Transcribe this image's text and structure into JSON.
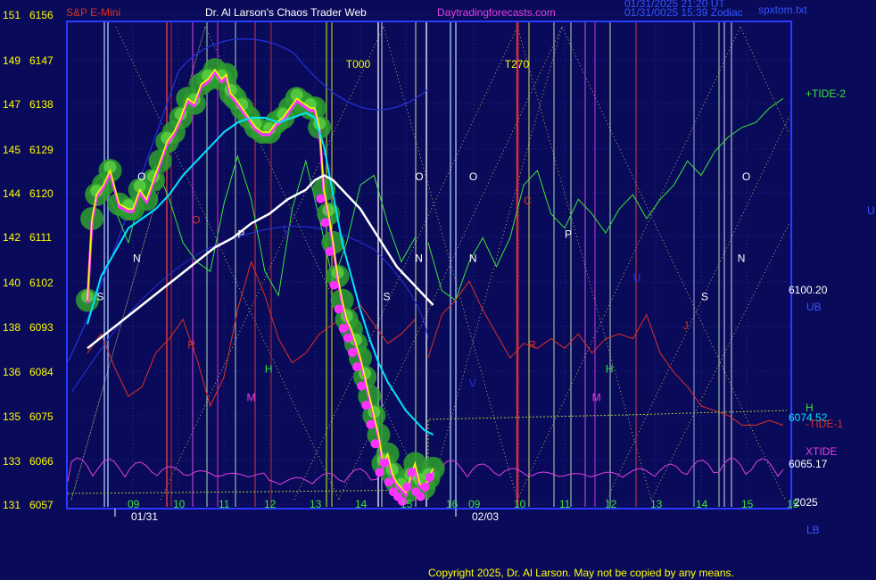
{
  "header": {
    "symbol": "S&P E-Mini",
    "author": "Dr. Al Larson's Chaos Trader Web",
    "site": "Daytradingforecasts.com",
    "stamp1": "01/31/2025 21:20 UT",
    "stamp2": "01/31/0025 15:39 Zodiac",
    "file": "spxtom.txt"
  },
  "footer": {
    "copyright": "Copyright 2025, Dr. Al Larson. May not be copied by any means."
  },
  "colors": {
    "background": "#0a0a5a",
    "frame": "#2a3aff",
    "price": "#ffff00",
    "price_glow": "#2ea02e",
    "avg_fast": "#00e5ff",
    "avg_slow": "#ffffff",
    "tide2": "#39e639",
    "tide1": "#e03020",
    "xtide": "#e040e0",
    "dots": "#ff33ff",
    "h_line": "#9acd32",
    "upper_band": "#2233dd"
  },
  "chart_data": {
    "type": "line",
    "title": "S&P E-Mini",
    "y_left": {
      "labels_a": [
        "151",
        "149",
        "147",
        "145",
        "144",
        "142",
        "140",
        "138",
        "136",
        "135",
        "133",
        "131"
      ],
      "labels_b": [
        "6156",
        "6147",
        "6138",
        "6129",
        "6120",
        "6111",
        "6102",
        "6093",
        "6084",
        "6075",
        "6066",
        "6057"
      ],
      "range": [
        6057,
        6156
      ]
    },
    "x_ticks": [
      {
        "label": "09",
        "day": 0,
        "hour": 9
      },
      {
        "label": "10",
        "day": 0,
        "hour": 10
      },
      {
        "label": "11",
        "day": 0,
        "hour": 11
      },
      {
        "label": "12",
        "day": 0,
        "hour": 12
      },
      {
        "label": "13",
        "day": 0,
        "hour": 13
      },
      {
        "label": "14",
        "day": 0,
        "hour": 14
      },
      {
        "label": "15",
        "day": 0,
        "hour": 15
      },
      {
        "label": "16",
        "day": 0,
        "hour": 16
      },
      {
        "label": "09",
        "day": 1,
        "hour": 9
      },
      {
        "label": "10",
        "day": 1,
        "hour": 10
      },
      {
        "label": "11",
        "day": 1,
        "hour": 11
      },
      {
        "label": "12",
        "day": 1,
        "hour": 12
      },
      {
        "label": "13",
        "day": 1,
        "hour": 13
      },
      {
        "label": "14",
        "day": 1,
        "hour": 14
      },
      {
        "label": "15",
        "day": 1,
        "hour": 15
      },
      {
        "label": "15",
        "day": 1,
        "hour": 16
      }
    ],
    "dates": [
      {
        "label": "01/31",
        "day": 0,
        "hour": 9
      },
      {
        "label": "02/03",
        "day": 1,
        "hour": 9
      }
    ],
    "year": "2025",
    "right_labels": {
      "upper": "U",
      "tide2": "+TIDE-2",
      "price": "6100.20",
      "ub": "UB",
      "h": "H",
      "level1": "6074.52",
      "tide1": "-TIDE-1",
      "xtide": "XTIDE",
      "level2": "6065.17",
      "lb": "LB"
    },
    "markers": [
      {
        "text": "T000",
        "day": 0,
        "hour": 13.8,
        "price": 6148
      },
      {
        "text": "T270",
        "day": 1,
        "hour": 9.8,
        "price": 6148
      }
    ],
    "planet_labels": [
      {
        "text": "O",
        "day": 0,
        "hour": 9.1,
        "price": 6125,
        "color": "#ffffff"
      },
      {
        "text": "N",
        "day": 0,
        "hour": 9.0,
        "price": 6108,
        "color": "#ffffff"
      },
      {
        "text": "S",
        "day": 0,
        "hour": 8.2,
        "price": 6100,
        "color": "#ffffff"
      },
      {
        "text": "O",
        "day": 0,
        "hour": 10.3,
        "price": 6116,
        "color": "#e03020"
      },
      {
        "text": "P",
        "day": 0,
        "hour": 11.3,
        "price": 6113,
        "color": "#ffffff"
      },
      {
        "text": "R",
        "day": 0,
        "hour": 10.2,
        "price": 6090,
        "color": "#e03020"
      },
      {
        "text": "H",
        "day": 0,
        "hour": 11.9,
        "price": 6085,
        "color": "#39e639"
      },
      {
        "text": "M",
        "day": 0,
        "hour": 11.5,
        "price": 6079,
        "color": "#e040e0"
      },
      {
        "text": "U",
        "day": 0,
        "hour": 12.3,
        "price": 6114,
        "color": "#2233dd"
      },
      {
        "text": "O",
        "day": 0,
        "hour": 15.2,
        "price": 6125,
        "color": "#ffffff"
      },
      {
        "text": "N",
        "day": 0,
        "hour": 15.2,
        "price": 6108,
        "color": "#ffffff"
      },
      {
        "text": "S",
        "day": 0,
        "hour": 14.5,
        "price": 6100,
        "color": "#ffffff"
      },
      {
        "text": "O",
        "day": 1,
        "hour": 8.9,
        "price": 6125,
        "color": "#ffffff"
      },
      {
        "text": "N",
        "day": 1,
        "hour": 8.9,
        "price": 6108,
        "color": "#ffffff"
      },
      {
        "text": "V",
        "day": 1,
        "hour": 8.9,
        "price": 6082,
        "color": "#2233dd"
      },
      {
        "text": "C",
        "day": 1,
        "hour": 10.1,
        "price": 6120,
        "color": "#e03020"
      },
      {
        "text": "R",
        "day": 1,
        "hour": 10.2,
        "price": 6090,
        "color": "#e03020"
      },
      {
        "text": "P",
        "day": 1,
        "hour": 11.0,
        "price": 6113,
        "color": "#ffffff"
      },
      {
        "text": "U",
        "day": 1,
        "hour": 12.5,
        "price": 6104,
        "color": "#2233dd"
      },
      {
        "text": "H",
        "day": 1,
        "hour": 11.9,
        "price": 6085,
        "color": "#39e639"
      },
      {
        "text": "M",
        "day": 1,
        "hour": 11.6,
        "price": 6079,
        "color": "#e040e0"
      },
      {
        "text": "J",
        "day": 1,
        "hour": 13.6,
        "price": 6094,
        "color": "#e03020"
      },
      {
        "text": "S",
        "day": 1,
        "hour": 14.0,
        "price": 6100,
        "color": "#ffffff"
      },
      {
        "text": "O",
        "day": 1,
        "hour": 14.9,
        "price": 6125,
        "color": "#ffffff"
      },
      {
        "text": "N",
        "day": 1,
        "hour": 14.8,
        "price": 6108,
        "color": "#ffffff"
      }
    ],
    "series": [
      {
        "name": "price",
        "x": [
          8.0,
          8.1,
          8.2,
          8.35,
          8.5,
          8.7,
          8.9,
          9.0,
          9.15,
          9.3,
          9.45,
          9.6,
          9.75,
          9.9,
          10.05,
          10.2,
          10.35,
          10.5,
          10.65,
          10.8,
          10.95,
          11.05,
          11.15,
          11.25,
          11.4,
          11.55,
          11.7,
          11.85,
          12.0,
          12.15,
          12.3,
          12.45,
          12.6,
          12.75,
          12.9,
          13.0,
          13.1,
          13.2,
          13.3,
          13.4,
          13.5,
          13.6,
          13.7,
          13.8,
          13.9,
          14.0,
          14.1,
          14.2,
          14.3,
          14.4,
          14.5,
          14.6,
          14.7,
          14.8,
          14.9,
          15.0,
          15.1,
          15.2,
          15.3,
          15.4,
          15.5,
          15.6
        ],
        "y": [
          6100,
          6117,
          6122,
          6124,
          6127,
          6120,
          6119,
          6119,
          6123,
          6121,
          6125,
          6129,
          6133,
          6135,
          6138,
          6142,
          6141,
          6145,
          6146,
          6148,
          6146,
          6147,
          6143,
          6142,
          6140,
          6138,
          6136,
          6135,
          6135,
          6137,
          6138,
          6140,
          6142,
          6141,
          6140,
          6140,
          6136,
          6123,
          6118,
          6112,
          6105,
          6100,
          6096,
          6094,
          6091,
          6088,
          6084,
          6080,
          6076,
          6072,
          6066,
          6068,
          6064,
          6062,
          6061,
          6060,
          6063,
          6066,
          6062,
          6061,
          6063,
          6065
        ]
      },
      {
        "name": "avg_fast",
        "x": [
          8.0,
          8.3,
          8.6,
          8.9,
          9.2,
          9.5,
          9.8,
          10.1,
          10.4,
          10.7,
          11.0,
          11.3,
          11.6,
          11.9,
          12.2,
          12.5,
          12.8,
          13.0,
          13.2,
          13.4,
          13.6,
          13.8,
          14.0,
          14.2,
          14.4,
          14.6,
          14.8,
          15.0,
          15.2,
          15.4,
          15.6
        ],
        "y": [
          6095,
          6105,
          6110,
          6115,
          6117,
          6119,
          6122,
          6126,
          6129,
          6132,
          6135,
          6137,
          6138,
          6138,
          6137,
          6138,
          6139,
          6138,
          6132,
          6122,
          6112,
          6105,
          6098,
          6092,
          6087,
          6083,
          6080,
          6077,
          6075,
          6073,
          6072
        ]
      },
      {
        "name": "avg_slow",
        "x": [
          8.0,
          8.4,
          8.8,
          9.2,
          9.6,
          10.0,
          10.4,
          10.8,
          11.2,
          11.6,
          12.0,
          12.4,
          12.8,
          13.0,
          13.2,
          13.4,
          13.6,
          13.8,
          14.0,
          14.2,
          14.4,
          14.6,
          14.8,
          15.0,
          15.2,
          15.4,
          15.6
        ],
        "y": [
          6090,
          6093,
          6096,
          6099,
          6102,
          6105,
          6108,
          6111,
          6113,
          6116,
          6118,
          6121,
          6123,
          6125,
          6126,
          6125,
          6123,
          6121,
          6119,
          6116,
          6113,
          6110,
          6107,
          6105,
          6103,
          6101,
          6099
        ]
      }
    ],
    "tides": {
      "tide2": {
        "x0": [
          8.0,
          8.3,
          8.6,
          8.9,
          9.2,
          9.5,
          9.8,
          10.1,
          10.4,
          10.7,
          11.0,
          11.3,
          11.6,
          11.9,
          12.2,
          12.5,
          12.8,
          13.1,
          13.4,
          13.7,
          14.0,
          14.3,
          14.6,
          14.9,
          15.2,
          15.5,
          15.8,
          16.0
        ],
        "y0": [
          6122,
          6126,
          6119,
          6112,
          6123,
          6128,
          6121,
          6112,
          6108,
          6106,
          6120,
          6130,
          6121,
          6106,
          6101,
          6119,
          6129,
          6117,
          6104,
          6112,
          6124,
          6126,
          6116,
          6108,
          6113,
          6121,
          6116,
          6119
        ],
        "x1": [
          8.0,
          8.3,
          8.6,
          8.9,
          9.2,
          9.5,
          9.8,
          10.1,
          10.4,
          10.7,
          11.0,
          11.3,
          11.6,
          11.9,
          12.2,
          12.5,
          12.8,
          13.1,
          13.4,
          13.7,
          14.0,
          14.3,
          14.6,
          14.9,
          15.2,
          15.5,
          15.8,
          16.0
        ],
        "y1": [
          6112,
          6102,
          6100,
          6108,
          6113,
          6107,
          6113,
          6124,
          6127,
          6118,
          6115,
          6121,
          6118,
          6114,
          6119,
          6122,
          6117,
          6121,
          6124,
          6129,
          6126,
          6131,
          6134,
          6136,
          6137,
          6140,
          6142,
          6144
        ]
      },
      "tide1": {
        "x0": [
          8.0,
          8.3,
          8.6,
          8.9,
          9.2,
          9.5,
          9.8,
          10.1,
          10.4,
          10.7,
          11.0,
          11.3,
          11.6,
          11.9,
          12.2,
          12.5,
          12.8,
          13.1,
          13.4,
          13.7,
          14.0,
          14.3,
          14.6,
          14.9,
          15.2,
          15.5,
          15.8,
          16.0
        ],
        "y0": [
          6089,
          6093,
          6086,
          6080,
          6082,
          6089,
          6092,
          6096,
          6088,
          6078,
          6084,
          6098,
          6108,
          6101,
          6092,
          6087,
          6089,
          6093,
          6095,
          6097,
          6099,
          6095,
          6091,
          6093,
          6096,
          6098,
          6094,
          6097
        ],
        "x1": [
          8.0,
          8.3,
          8.6,
          8.9,
          9.2,
          9.5,
          9.8,
          10.1,
          10.4,
          10.7,
          11.0,
          11.3,
          11.6,
          11.9,
          12.2,
          12.5,
          12.8,
          13.1,
          13.4,
          13.7,
          14.0,
          14.3,
          14.6,
          14.9,
          15.2,
          15.5,
          15.8,
          16.0
        ],
        "y1": [
          6088,
          6097,
          6100,
          6104,
          6098,
          6093,
          6088,
          6091,
          6090,
          6092,
          6090,
          6093,
          6089,
          6092,
          6093,
          6092,
          6097,
          6089,
          6085,
          6082,
          6078,
          6077,
          6076,
          6074,
          6074,
          6075,
          6074,
          6074
        ]
      }
    }
  }
}
